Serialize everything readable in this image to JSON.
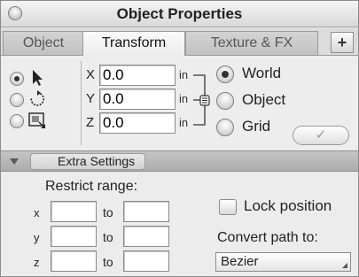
{
  "window": {
    "title": "Object Properties"
  },
  "tabs": [
    {
      "label": "Object"
    },
    {
      "label": "Transform"
    },
    {
      "label": "Texture & FX"
    }
  ],
  "add_tab_icon": "plus-icon",
  "transform": {
    "tool_modes": [
      {
        "icon": "move-arrow-icon",
        "selected": true
      },
      {
        "icon": "rotate-icon",
        "selected": false
      },
      {
        "icon": "scale-icon",
        "selected": false
      }
    ],
    "coordinates": [
      {
        "axis": "X",
        "value": "0.0",
        "unit": "in"
      },
      {
        "axis": "Y",
        "value": "0.0",
        "unit": "in"
      },
      {
        "axis": "Z",
        "value": "0.0",
        "unit": "in"
      }
    ],
    "link_icon": "link-bracket-icon",
    "spaces": [
      {
        "label": "World",
        "selected": true
      },
      {
        "label": "Object",
        "selected": false
      },
      {
        "label": "Grid",
        "selected": false
      }
    ],
    "apply_button_label": "✓"
  },
  "extra_settings": {
    "title": "Extra Settings",
    "restrict_range_label": "Restrict range:",
    "ranges": [
      {
        "axis": "x",
        "from": "",
        "to_label": "to",
        "to": ""
      },
      {
        "axis": "y",
        "from": "",
        "to_label": "to",
        "to": ""
      },
      {
        "axis": "z",
        "from": "",
        "to_label": "to",
        "to": ""
      }
    ],
    "lock_position_label": "Lock position",
    "lock_position_checked": false,
    "convert_path_label": "Convert path to:",
    "convert_path_value": "Bezier"
  }
}
